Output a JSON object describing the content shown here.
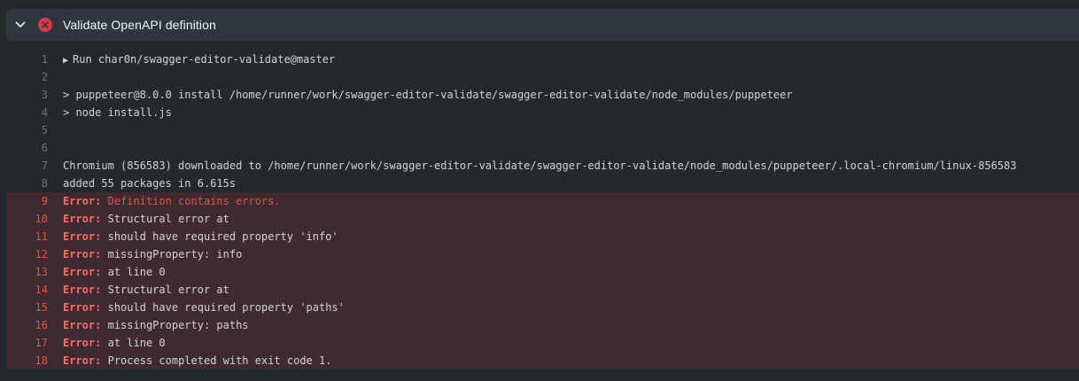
{
  "step": {
    "title": "Validate OpenAPI definition",
    "status": "failed"
  },
  "log": {
    "lines": [
      {
        "num": "1",
        "text": "Run char0n/swagger-editor-validate@master",
        "collapsible": true
      },
      {
        "num": "2",
        "text": ""
      },
      {
        "num": "3",
        "text": "> puppeteer@8.0.0 install /home/runner/work/swagger-editor-validate/swagger-editor-validate/node_modules/puppeteer"
      },
      {
        "num": "4",
        "text": "> node install.js"
      },
      {
        "num": "5",
        "text": ""
      },
      {
        "num": "6",
        "text": ""
      },
      {
        "num": "7",
        "text": "Chromium (856583) downloaded to /home/runner/work/swagger-editor-validate/swagger-editor-validate/node_modules/puppeteer/.local-chromium/linux-856583"
      },
      {
        "num": "8",
        "text": "added 55 packages in 6.615s"
      }
    ],
    "errors": [
      {
        "num": "9",
        "prefix": "Error:",
        "text": "Definition contains errors.",
        "highlight": true
      },
      {
        "num": "10",
        "prefix": "Error:",
        "text": "Structural error at"
      },
      {
        "num": "11",
        "prefix": "Error:",
        "text": "should have required property 'info'"
      },
      {
        "num": "12",
        "prefix": "Error:",
        "text": "missingProperty: info"
      },
      {
        "num": "13",
        "prefix": "Error:",
        "text": "at line 0"
      },
      {
        "num": "14",
        "prefix": "Error:",
        "text": "Structural error at"
      },
      {
        "num": "15",
        "prefix": "Error:",
        "text": "should have required property 'paths'"
      },
      {
        "num": "16",
        "prefix": "Error:",
        "text": "missingProperty: paths"
      },
      {
        "num": "17",
        "prefix": "Error:",
        "text": "at line 0"
      },
      {
        "num": "18",
        "prefix": "Error:",
        "text": "Process completed with exit code 1."
      }
    ]
  },
  "colors": {
    "background": "#24292e",
    "header": "#2f363d",
    "error_row": "#3e2a30",
    "error_text": "#f47067",
    "fail_icon": "#d73a49"
  }
}
